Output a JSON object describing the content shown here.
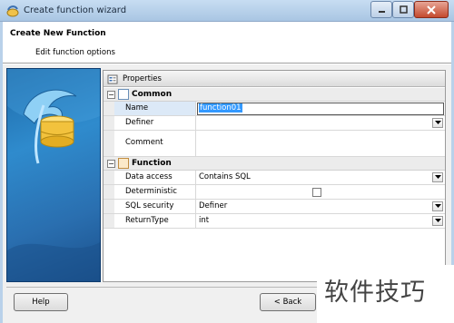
{
  "window": {
    "title": "Create function wizard"
  },
  "header": {
    "title": "Create New Function",
    "subtitle": "Edit function options"
  },
  "properties": {
    "title": "Properties",
    "categories": [
      {
        "label": "Common",
        "items": [
          {
            "name": "Name",
            "value": "function01"
          },
          {
            "name": "Definer",
            "value": ""
          },
          {
            "name": "Comment",
            "value": ""
          }
        ]
      },
      {
        "label": "Function",
        "items": [
          {
            "name": "Data access",
            "value": "Contains SQL"
          },
          {
            "name": "Deterministic",
            "value": ""
          },
          {
            "name": "SQL security",
            "value": "Definer"
          },
          {
            "name": "ReturnType",
            "value": "int"
          }
        ]
      }
    ]
  },
  "buttons": {
    "help": "Help",
    "back": "< Back"
  },
  "watermark": "软件技巧",
  "colors": {
    "side_panel": "#2f8bcd",
    "selection": "#3399ff",
    "close_button": "#c44a2e"
  }
}
